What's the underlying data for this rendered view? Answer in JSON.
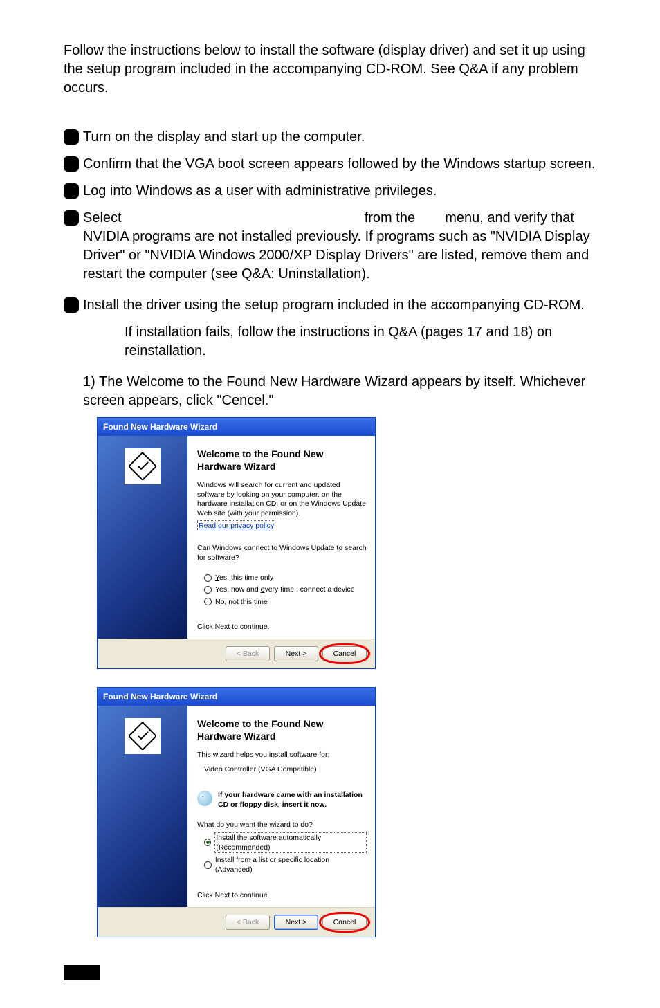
{
  "intro": "Follow the instructions below to install the software (display driver) and set it up using the setup program included in the accompanying CD-ROM. See Q&A if any problem occurs.",
  "steps": {
    "s1": "Turn on the display and start up the computer.",
    "s2": "Confirm that the VGA boot screen appears followed by the Windows startup screen.",
    "s3": "Log into Windows as a user with administrative privileges.",
    "s4_a": "Select",
    "s4_b": "from the",
    "s4_c": "menu, and verify that",
    "s4_rest": "NVIDIA programs are not installed previously. If programs such as \"NVIDIA Display Driver\" or \"NVIDIA Windows 2000/XP Display Drivers\" are listed, remove them and restart the computer (see Q&A: Uninstallation).",
    "s5": "Install the driver using the setup program included in the accompanying CD-ROM.",
    "s5_sub": "If installation fails, follow the instructions in Q&A (pages 17 and 18) on reinstallation.",
    "s5_1": "1) The Welcome to the Found New Hardware Wizard appears by itself. Whichever screen appears, click \"Cencel.\""
  },
  "dialog1": {
    "title": "Found New Hardware Wizard",
    "heading": "Welcome to the Found New Hardware Wizard",
    "body1": "Windows will search for current and updated software by looking on your computer, on the hardware installation CD, or on the Windows Update Web site (with your permission).",
    "privacy": "Read our privacy policy",
    "question": "Can Windows connect to Windows Update to search for software?",
    "opt1": "Yes, this time only",
    "opt2": "Yes, now and every time I connect a device",
    "opt3": "No, not this time",
    "continue": "Click Next to continue.",
    "btn_back": "< Back",
    "btn_next": "Next >",
    "btn_cancel": "Cancel"
  },
  "dialog2": {
    "title": "Found New Hardware Wizard",
    "heading": "Welcome to the Found New Hardware Wizard",
    "intro": "This wizard helps you install software for:",
    "device": "Video Controller (VGA Compatible)",
    "tip": "If your hardware came with an installation CD or floppy disk, insert it now.",
    "question": "What do you want the wizard to do?",
    "opt1": "Install the software automatically (Recommended)",
    "opt2": "Install from a list or specific location (Advanced)",
    "continue": "Click Next to continue.",
    "btn_back": "< Back",
    "btn_next": "Next >",
    "btn_cancel": "Cancel"
  }
}
